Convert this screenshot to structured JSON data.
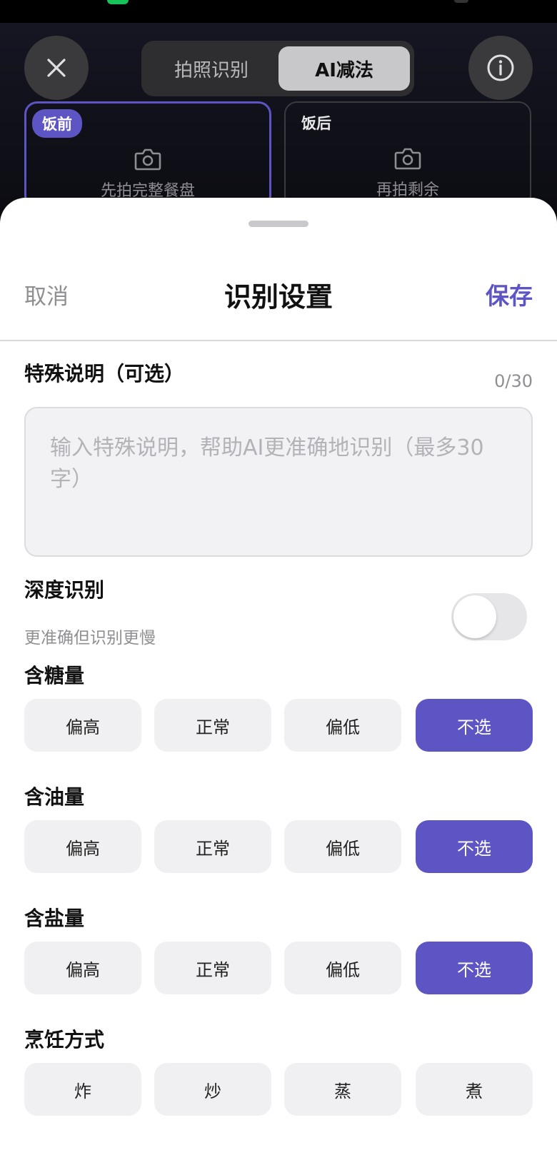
{
  "top_bar": {
    "mode_tabs": [
      {
        "label": "拍照识别",
        "active": false
      },
      {
        "label": "AI减法",
        "active": true
      }
    ],
    "close_icon": "close-icon",
    "info_icon": "info-icon"
  },
  "photo_cards": [
    {
      "tag": "饭前",
      "hint": "先拍完整餐盘",
      "icon": "camera-icon",
      "selected": true
    },
    {
      "tag": "饭后",
      "hint": "再拍剩余",
      "icon": "camera-icon",
      "selected": false
    }
  ],
  "sheet": {
    "cancel_label": "取消",
    "title": "识别设置",
    "save_label": "保存",
    "note": {
      "label": "特殊说明（可选）",
      "counter": "0/30",
      "value": "",
      "placeholder": "输入特殊说明，帮助AI更准确地识别（最多30字）"
    },
    "deep_recognition": {
      "label": "深度识别",
      "sublabel": "更准确但识别更慢",
      "enabled": false
    },
    "sugar": {
      "label": "含糖量",
      "options": [
        "偏高",
        "正常",
        "偏低",
        "不选"
      ],
      "selected": "不选"
    },
    "oil": {
      "label": "含油量",
      "options": [
        "偏高",
        "正常",
        "偏低",
        "不选"
      ],
      "selected": "不选"
    },
    "salt": {
      "label": "含盐量",
      "options": [
        "偏高",
        "正常",
        "偏低",
        "不选"
      ],
      "selected": "不选"
    },
    "cooking": {
      "label": "烹饪方式",
      "options": [
        "炸",
        "炒",
        "蒸",
        "煮"
      ]
    }
  },
  "colors": {
    "accent": "#5d55c3",
    "option_bg": "#f0f0f2",
    "sheet_bg": "#ffffff"
  }
}
